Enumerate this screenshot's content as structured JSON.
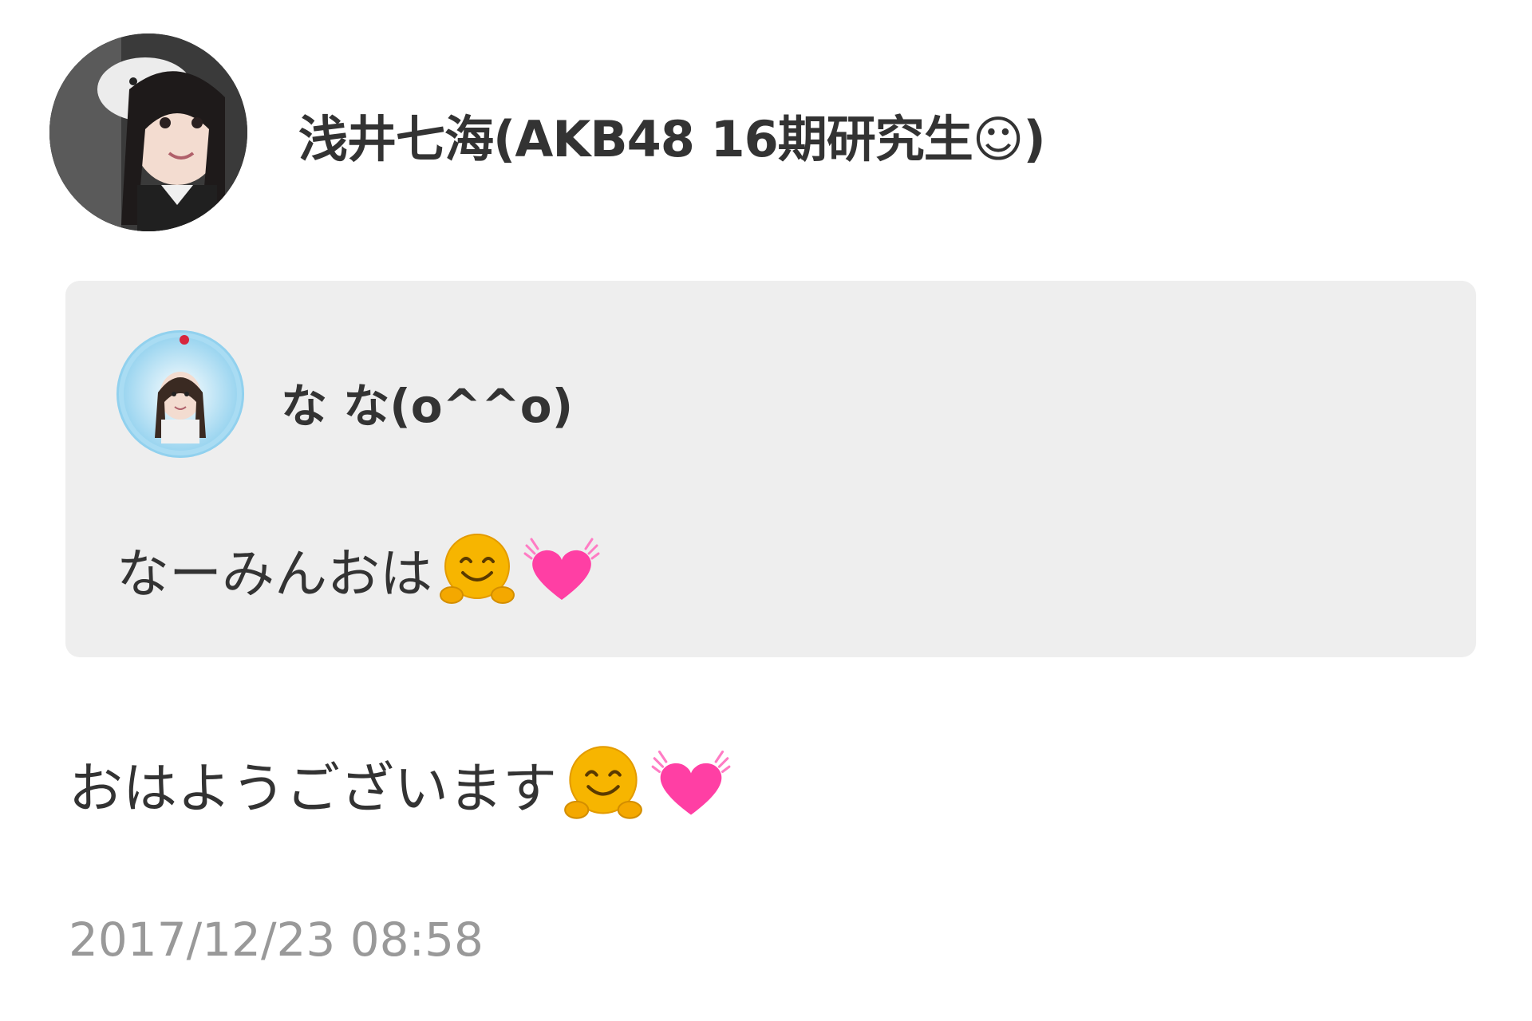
{
  "post": {
    "author": {
      "name": "浅井七海(AKB48 16期研究生☺)",
      "avatar_icon": "author-avatar"
    },
    "quote": {
      "author_name": "な な(o^^o)",
      "avatar_icon": "quoted-user-avatar",
      "text": "なーみんおは",
      "emojis": [
        "hugging-face-emoji",
        "beating-heart-emoji"
      ]
    },
    "text": "おはようございます",
    "emojis": [
      "hugging-face-emoji",
      "beating-heart-emoji"
    ],
    "timestamp": "2017/12/23 08:58"
  },
  "colors": {
    "text": "#333333",
    "timestamp": "#999999",
    "card_bg": "#eeeeee",
    "heart": "#ff3fa4",
    "smiley": "#f7b500"
  }
}
